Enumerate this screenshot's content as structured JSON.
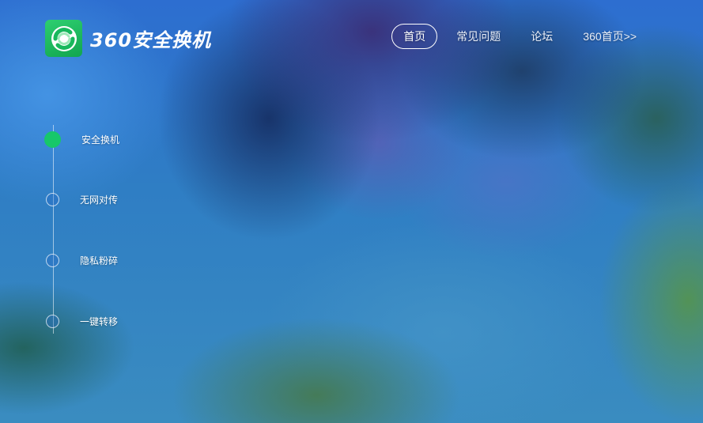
{
  "header": {
    "logo_text": "360安全换机",
    "nav": [
      {
        "label": "首页",
        "active": true
      },
      {
        "label": "常见问题",
        "active": false
      },
      {
        "label": "论坛",
        "active": false
      },
      {
        "label": "360首页>>",
        "active": false
      }
    ]
  },
  "sidebar": {
    "items": [
      {
        "label": "安全换机",
        "active": true
      },
      {
        "label": "无网对传",
        "active": false
      },
      {
        "label": "隐私粉碎",
        "active": false
      },
      {
        "label": "一键转移",
        "active": false
      }
    ]
  },
  "colors": {
    "accent_green": "#17c76a",
    "logo_green": "#2ecf70"
  },
  "icons": {
    "logo": "360-exchange-logo-icon"
  }
}
